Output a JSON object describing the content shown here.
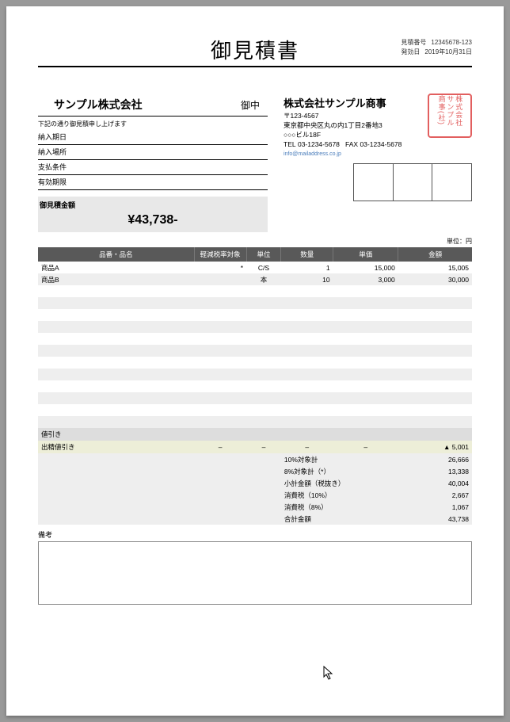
{
  "header": {
    "title": "御見積書",
    "quoteNoLabel": "見積番号",
    "quoteNo": "12345678-123",
    "issueLabel": "発効日",
    "issueDate": "2019年10月31日"
  },
  "customer": {
    "name": "サンプル株式会社",
    "honorific": "御中",
    "intro": "下記の通り御見積申し上げます",
    "fields": {
      "deliveryDate": "納入期日",
      "deliveryPlace": "納入場所",
      "payment": "支払条件",
      "validUntil": "有効期限"
    }
  },
  "vendor": {
    "name": "株式会社サンプル商事",
    "postal": "〒123-4567",
    "addr1": "東京都中央区丸の内1丁目2番地3",
    "addr2": "○○○ビル18F",
    "telLabel": "TEL",
    "tel": "03-1234-5678",
    "faxLabel": "FAX",
    "fax": "03-1234-5678",
    "mail": "info@mailaddress.co.jp",
    "seal": "株式会社\nサンプル\n商事(社)"
  },
  "total": {
    "label": "御見積金額",
    "value": "¥43,738-"
  },
  "unitNote": "単位：円",
  "columns": {
    "name": "品番・品名",
    "reduced": "軽減税率対象",
    "unit": "単位",
    "qty": "数量",
    "price": "単価",
    "amount": "金額"
  },
  "items": [
    {
      "name": "商品A",
      "reduced": "*",
      "unit": "C/S",
      "qty": "1",
      "price": "15,000",
      "amount": "15,005"
    },
    {
      "name": "商品B",
      "reduced": "",
      "unit": "本",
      "qty": "10",
      "price": "3,000",
      "amount": "30,000"
    },
    {},
    {},
    {},
    {},
    {},
    {},
    {},
    {},
    {},
    {},
    {},
    {}
  ],
  "discounts": [
    {
      "label": "値引き",
      "reduced": "",
      "unit": "",
      "qty": "",
      "price": "",
      "amount": ""
    },
    {
      "label": "出精値引き",
      "reduced": "–",
      "unit": "–",
      "qty": "–",
      "price": "–",
      "amount": "▲ 5,001"
    }
  ],
  "summary": [
    {
      "label": "10%対象計",
      "value": "26,666"
    },
    {
      "label": "8%対象計（*）",
      "value": "13,338"
    },
    {
      "label": "小計金額（税抜き）",
      "value": "40,004"
    },
    {
      "label": "消費税（10%）",
      "value": "2,667"
    },
    {
      "label": "消費税（8%）",
      "value": "1,067"
    },
    {
      "label": "合計金額",
      "value": "43,738"
    }
  ],
  "notesLabel": "備考"
}
